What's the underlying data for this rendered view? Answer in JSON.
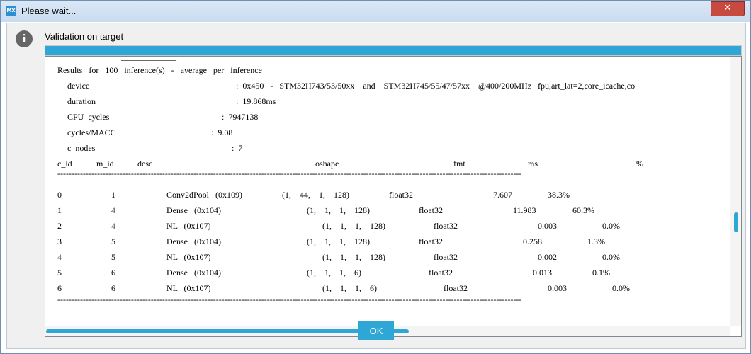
{
  "window": {
    "app_icon_text": "MX",
    "title": "Please wait...",
    "close_glyph": "✕"
  },
  "dialog": {
    "heading": "Validation on target",
    "progress_fraction": 1.0,
    "ok_label": "OK"
  },
  "console": {
    "results_header": "Results   for   100   inference(s)   -   average   per   inference",
    "device_key": "device",
    "device_val": ":  0x450   -   STM32H743/53/50xx    and    STM32H745/55/47/57xx    @400/200MHz   fpu,art_lat=2,core_icache,co",
    "duration_key": "duration",
    "duration_val": ":  19.868ms",
    "cpu_cycles_key": "CPU  cycles",
    "cpu_cycles_val": ":  7947138",
    "cycles_macc_key": "cycles/MACC",
    "cycles_macc_val": ":  9.08",
    "c_nodes_key": "c_nodes",
    "c_nodes_val": ":  7",
    "columns": {
      "c_id": "c_id",
      "m_id": "m_id",
      "desc": "desc",
      "oshape": "oshape",
      "fmt": "fmt",
      "ms": "ms",
      "pct": "%"
    },
    "separator": "--------------------------------------------------------------------------------------------------------------------------------------------------------------------",
    "rows": [
      {
        "c_id": "0",
        "m_id": "1",
        "desc": "Conv2dPool   (0x109)",
        "oshape": "(1,    44,    1,    128)",
        "fmt": "float32",
        "ms": "7.607",
        "pct": "38.3%"
      },
      {
        "c_id": "1",
        "m_id": "4",
        "desc": "Dense   (0x104)",
        "oshape": "(1,    1,    1,    128)",
        "fmt": "float32",
        "ms": "11.983",
        "pct": "60.3%"
      },
      {
        "c_id": "2",
        "m_id": "4",
        "desc": "NL   (0x107)",
        "oshape": "(1,    1,    1,    128)",
        "fmt": "float32",
        "ms": "0.003",
        "pct": "0.0%"
      },
      {
        "c_id": "3",
        "m_id": "5",
        "desc": "Dense   (0x104)",
        "oshape": "(1,    1,    1,    128)",
        "fmt": "float32",
        "ms": "0.258",
        "pct": "1.3%"
      },
      {
        "c_id": "4",
        "m_id": "5",
        "desc": "NL   (0x107)",
        "oshape": "(1,    1,    1,    128)",
        "fmt": "float32",
        "ms": "0.002",
        "pct": "0.0%"
      },
      {
        "c_id": "5",
        "m_id": "6",
        "desc": "Dense   (0x104)",
        "oshape": "(1,    1,    1,    6)",
        "fmt": "float32",
        "ms": "0.013",
        "pct": "0.1%"
      },
      {
        "c_id": "6",
        "m_id": "6",
        "desc": "NL   (0x107)",
        "oshape": "(1,    1,    1,    6)",
        "fmt": "float32",
        "ms": "0.003",
        "pct": "0.0%"
      }
    ]
  }
}
